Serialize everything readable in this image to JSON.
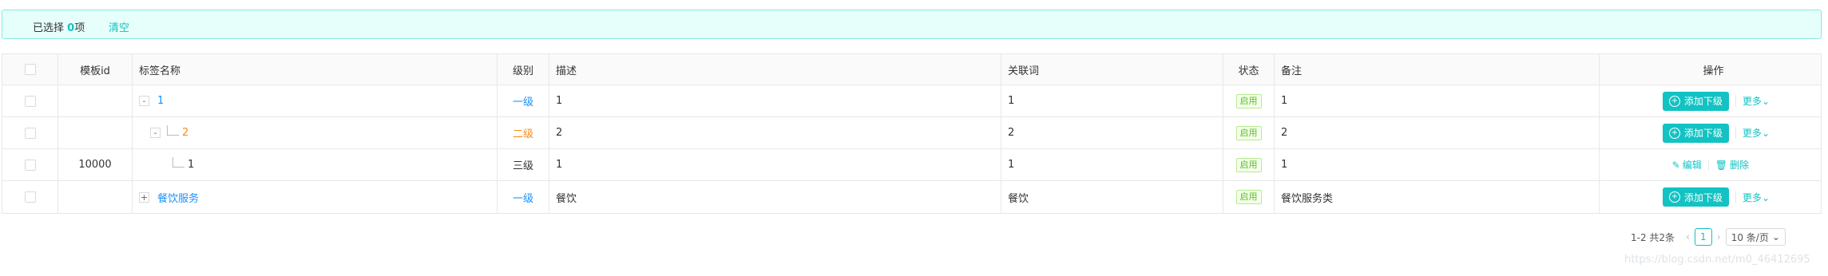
{
  "alert": {
    "selected_prefix": "已选择",
    "selected_count": "0",
    "selected_suffix": "项",
    "clear_label": "清空"
  },
  "table": {
    "headers": {
      "template_id": "模板id",
      "tag_name": "标签名称",
      "level": "级别",
      "desc": "描述",
      "keywords": "关联词",
      "status": "状态",
      "note": "备注",
      "ops": "操作"
    },
    "rows": [
      {
        "template_id": "",
        "expander": "-",
        "name": "1",
        "level": "一级",
        "desc": "1",
        "keywords": "1",
        "status": "启用",
        "note": "1",
        "add_label": "添加下级",
        "more_label": "更多"
      },
      {
        "template_id": "",
        "expander": "-",
        "name": "2",
        "level": "二级",
        "desc": "2",
        "keywords": "2",
        "status": "启用",
        "note": "2",
        "add_label": "添加下级",
        "more_label": "更多"
      },
      {
        "template_id": "10000",
        "expander": "",
        "name": "1",
        "level": "三级",
        "desc": "1",
        "keywords": "1",
        "status": "启用",
        "note": "1",
        "edit_label": "编辑",
        "delete_label": "删除"
      },
      {
        "template_id": "",
        "expander": "+",
        "name": "餐饮服务",
        "level": "一级",
        "desc": "餐饮",
        "keywords": "餐饮",
        "status": "启用",
        "note": "餐饮服务类",
        "add_label": "添加下级",
        "more_label": "更多"
      }
    ]
  },
  "pagination": {
    "summary": "1-2 共2条",
    "current_page": "1",
    "page_size": "10 条/页"
  },
  "watermark": "https://blog.csdn.net/m0_46412695",
  "colors": {
    "accent": "#13c2c2",
    "level1": "#1890ff",
    "level2": "#fa8c16",
    "status_green": "#52c41a"
  }
}
